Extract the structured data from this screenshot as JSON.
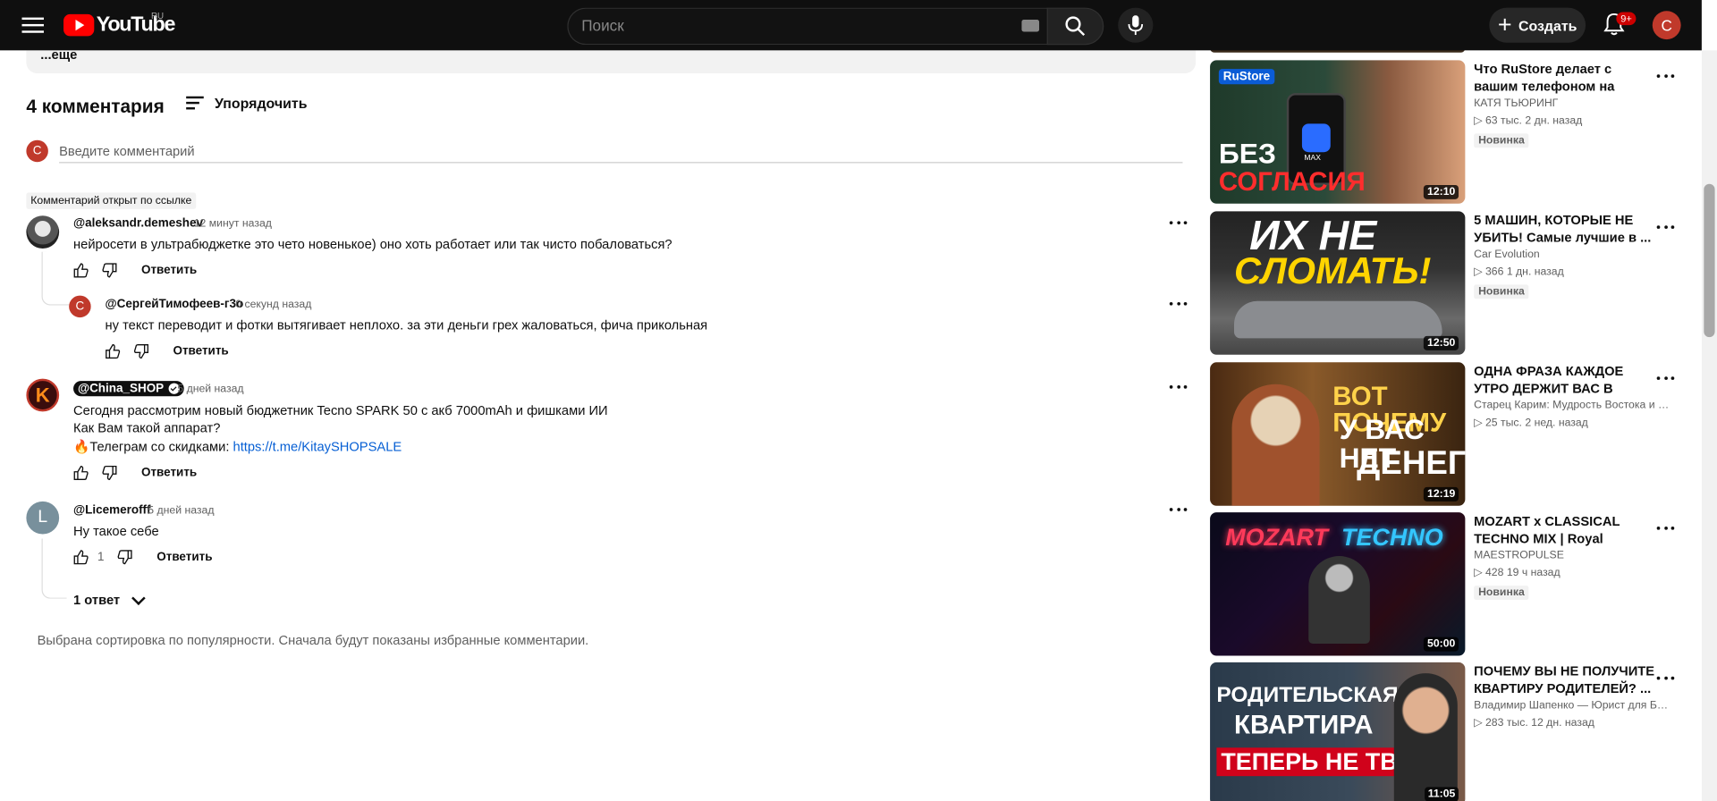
{
  "header": {
    "logo_text": "YouTube",
    "logo_region": "RU",
    "search_placeholder": "Поиск",
    "create_label": "Создать",
    "notif_badge": "9+",
    "avatar_letter": "С"
  },
  "comments": {
    "description_more": "...еще",
    "count_label": "4 комментария",
    "sort_label": "Упорядочить",
    "add_placeholder": "Введите комментарий",
    "me_avatar_letter": "С",
    "linked_label": "Комментарий открыт по ссылке",
    "reply_label": "Ответить",
    "items": [
      {
        "author": "@aleksandr.demeshev",
        "time": "12 минут назад",
        "text": "нейросети в ультрабюджетке это чето новенькое) оно хоть работает или так чисто побаловаться?"
      },
      {
        "author": "@СергейТимофеев-г3о",
        "time": "0 секунд назад",
        "text": "ну текст переводит и фотки вытягивает неплохо. за эти деньги грех жаловаться, фича прикольная",
        "avatar_letter": "С"
      },
      {
        "author": "@China_SHOP",
        "time": "5 дней назад",
        "line1": "Сегодня рассмотрим новый бюджетник Tecno SPARK 50 с акб 7000mAh и фишками ИИ",
        "line2": "Как Вам такой аппарат?",
        "line3": "🔥Телеграм со скидками: ",
        "link": "https://t.me/KitaySHOPSALE",
        "avatar_letter": "K"
      },
      {
        "author": "@Licemerofff",
        "time": "5 дней назад",
        "text": "Ну такое себе",
        "likes": "1",
        "avatar_letter": "L",
        "replies_label": "1 ответ"
      }
    ],
    "sort_note": "Выбрана сортировка по популярности. Сначала будут показаны избранные комментарии."
  },
  "sidebar": {
    "videos": [
      {
        "title": "Что RuStore делает с вашим телефоном на самом деле?",
        "channel": "КАТЯ ТЬЮРИНГ",
        "meta": "▷ 63 тыс.   2 дн. назад",
        "badge": "Новинка",
        "duration": "12:10",
        "thumb_text1": "БЕЗ",
        "thumb_text2": "СОГЛАСИЯ",
        "thumb_logo": "RuStore",
        "thumb_logo2": "MAX"
      },
      {
        "title": "5 МАШИН, КОТОРЫЕ НЕ УБИТЬ! Самые лучшие в ...",
        "channel": "Car Evolution",
        "meta": "▷ 366   1 дн. назад",
        "badge": "Новинка",
        "duration": "12:50",
        "thumb_text1": "ИХ НЕ",
        "thumb_text2": "СЛОМАТЬ!"
      },
      {
        "title": "ОДНА ФРАЗА КАЖДОЕ УТРО ДЕРЖИТ ВАС В НИЩЕТЕ. ...",
        "channel": "Старец Карим: Мудрость Востока   и С...",
        "meta": "▷ 25 тыс.   2 нед. назад",
        "duration": "12:19",
        "thumb_text1": "ВОТ ПОЧЕМУ",
        "thumb_text2": "У ВАС НЕТ",
        "thumb_text3": "ДЕНЕГ"
      },
      {
        "title": "MOZART x CLASSICAL TECHNO MIX | Royal Symphon...",
        "channel": "MAESTROPULSE",
        "meta": "▷ 428   19 ч назад",
        "badge": "Новинка",
        "duration": "50:00",
        "thumb_text1": "MOZART",
        "thumb_text2": "TECHNO"
      },
      {
        "title": "ПОЧЕМУ ВЫ НЕ ПОЛУЧИТЕ КВАРТИРУ РОДИТЕЛЕЙ? ...",
        "channel": "Владимир Шапенко — Юрист для Биз...",
        "meta": "▷ 283 тыс.   12 дн. назад",
        "duration": "11:05",
        "thumb_text1": "РОДИТЕЛЬСКАЯ",
        "thumb_text2": "КВАРТИРА",
        "thumb_text3": "ТЕПЕРЬ НЕ ТВОЯ"
      }
    ]
  },
  "colors": {
    "topbar": "#0f0f0f",
    "brand_red": "#ff0000",
    "link": "#065fd4",
    "avatar_me": "#c0392b"
  }
}
